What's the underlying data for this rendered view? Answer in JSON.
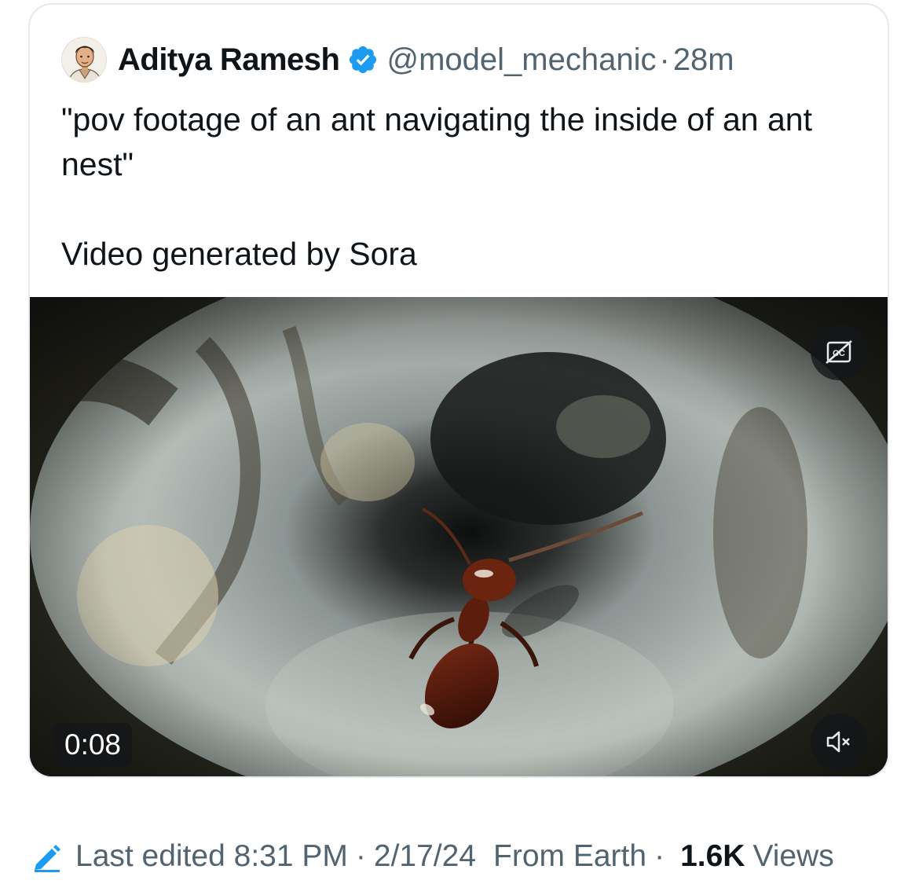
{
  "post": {
    "author_name": "Aditya Ramesh",
    "handle": "@model_mechanic",
    "separator": "·",
    "time": "28m",
    "text": "\"pov footage of an ant navigating the inside of an ant nest\"\n\nVideo generated by Sora"
  },
  "video": {
    "duration": "0:08",
    "captions_icon": "closed-captions-icon",
    "mute_icon": "speaker-muted-icon"
  },
  "footer": {
    "edited_label": "Last edited 8:31 PM",
    "separator": "·",
    "date": "2/17/24",
    "location": "From Earth",
    "views_count": "1.6K",
    "views_label": "Views"
  },
  "colors": {
    "verified": "#1d9bf0",
    "secondary_text": "#536471",
    "primary_text": "#0f1419",
    "card_border": "#e6e9ec"
  }
}
